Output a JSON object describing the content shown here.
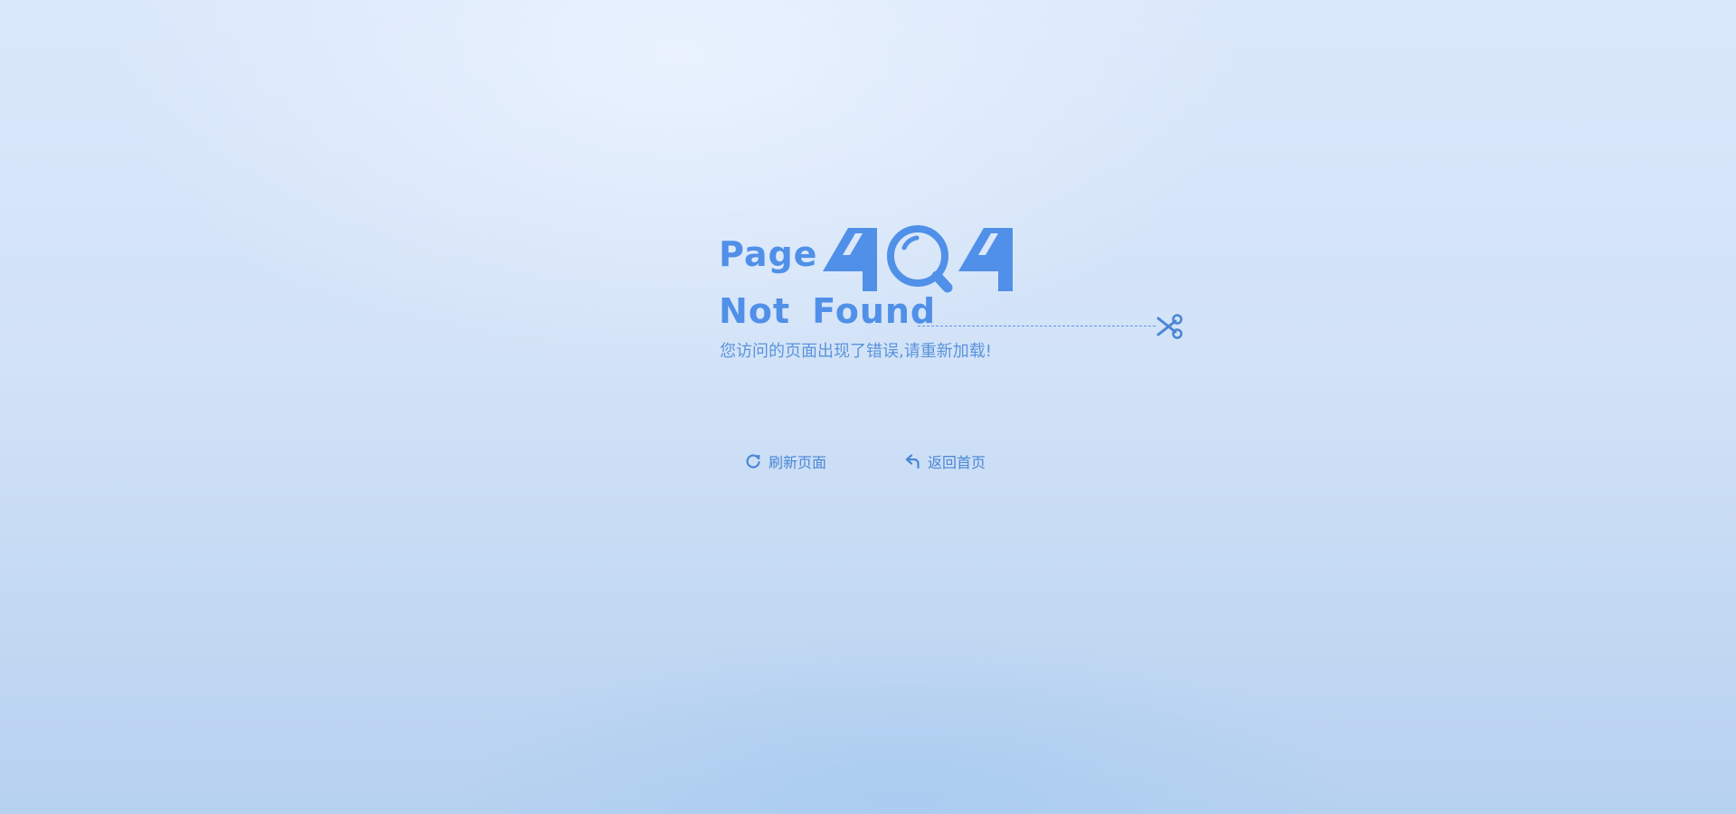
{
  "error": {
    "page_word": "Page",
    "code": "404",
    "not_found": "Not Found",
    "message": "您访问的页面出现了错误,请重新加载!"
  },
  "actions": {
    "refresh_label": "刷新页面",
    "home_label": "返回首页"
  },
  "icons": {
    "refresh": "refresh-icon",
    "back": "return-arrow-icon",
    "scissors": "scissors-icon",
    "magnifier": "magnifier-icon"
  },
  "colors": {
    "accent": "#5090e8",
    "text": "#5a94dc",
    "background_top": "#dae8fb",
    "background_bottom": "#b6d1f0"
  }
}
